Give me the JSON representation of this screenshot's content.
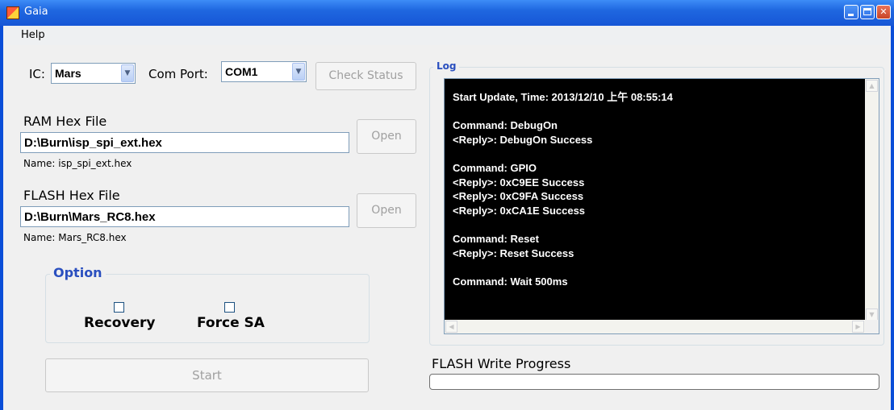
{
  "window": {
    "title": "Gaia"
  },
  "menu": {
    "help": "Help"
  },
  "connection": {
    "ic_label": "IC:",
    "ic_value": "Mars",
    "com_port_label": "Com Port:",
    "com_port_value": "COM1",
    "check_status_label": "Check Status"
  },
  "ram": {
    "label": "RAM Hex File",
    "path": "D:\\Burn\\isp_spi_ext.hex",
    "open_label": "Open",
    "name_text": "Name: isp_spi_ext.hex"
  },
  "flash": {
    "label": "FLASH Hex File",
    "path": "D:\\Burn\\Mars_RC8.hex",
    "open_label": "Open",
    "name_text": "Name: Mars_RC8.hex"
  },
  "option": {
    "title": "Option",
    "recovery_label": "Recovery",
    "recovery_checked": false,
    "force_sa_label": "Force SA",
    "force_sa_checked": false
  },
  "start_label": "Start",
  "log": {
    "title": "Log",
    "lines": [
      "Start Update, Time: 2013/12/10 上午 08:55:14",
      "",
      "Command: DebugOn",
      "<Reply>: DebugOn Success",
      "",
      "Command: GPIO",
      "<Reply>: 0xC9EE Success",
      "<Reply>: 0xC9FA Success",
      "<Reply>: 0xCA1E Success",
      "",
      "Command: Reset",
      "<Reply>: Reset Success",
      "",
      "Command: Wait 500ms"
    ]
  },
  "progress": {
    "label": "FLASH Write Progress",
    "value": 0
  },
  "icons": {
    "app": "app-icon",
    "minimize": "minimize-icon",
    "maximize": "maximize-icon",
    "close": "close-icon",
    "dropdown": "chevron-down-icon"
  }
}
